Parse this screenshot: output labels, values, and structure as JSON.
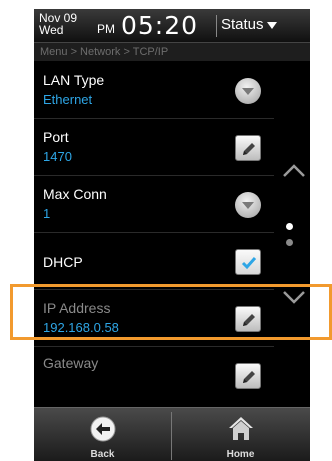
{
  "status_bar": {
    "month_day": "Nov 09",
    "weekday": "Wed",
    "ampm": "PM",
    "time": "05:20",
    "status_label": "Status"
  },
  "breadcrumb": "Menu > Network > TCP/IP",
  "rows": [
    {
      "label": "LAN Type",
      "value": "Ethernet",
      "control": "dropdown"
    },
    {
      "label": "Port",
      "value": "1470",
      "control": "edit"
    },
    {
      "label": "Max Conn",
      "value": "1",
      "control": "dropdown"
    },
    {
      "label": "DHCP",
      "value": "",
      "control": "checkbox",
      "checked": true
    },
    {
      "label": "IP Address",
      "value": "192.168.0.58",
      "control": "edit",
      "dimmed_label": true
    },
    {
      "label": "Gateway",
      "value": "",
      "control": "edit",
      "dimmed_label": true
    }
  ],
  "bottom_bar": {
    "back_label": "Back",
    "home_label": "Home"
  },
  "colors": {
    "accent_value": "#2ea6e6",
    "highlight": "#f29a2e"
  },
  "icons": [
    "chevron-down-icon",
    "pencil-icon",
    "checkmark-icon",
    "chevron-up-icon",
    "back-arrow-icon",
    "home-icon"
  ]
}
